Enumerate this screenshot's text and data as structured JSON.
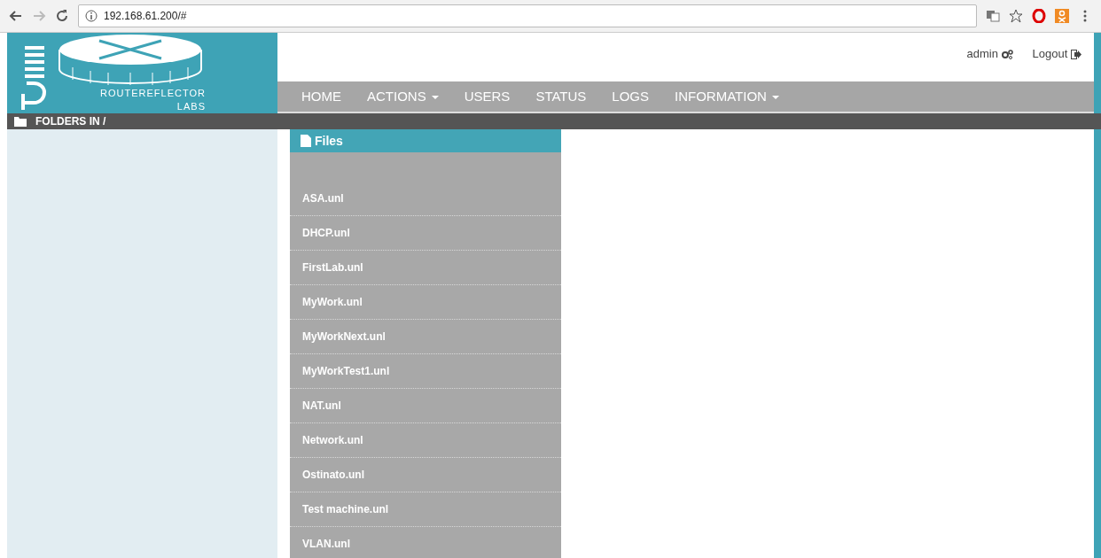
{
  "browser": {
    "address": "192.168.61.200/#"
  },
  "logo": {
    "line_1": "ROUTEREFLECTOR",
    "line_2": "LABS"
  },
  "user_menu": {
    "user": "admin",
    "logout": "Logout"
  },
  "nav": [
    {
      "label": "HOME",
      "dropdown": false
    },
    {
      "label": "ACTIONS",
      "dropdown": true
    },
    {
      "label": "USERS",
      "dropdown": false
    },
    {
      "label": "STATUS",
      "dropdown": false
    },
    {
      "label": "LOGS",
      "dropdown": false
    },
    {
      "label": "INFORMATION",
      "dropdown": true
    }
  ],
  "folders_bar": {
    "title": "FOLDERS IN /"
  },
  "files": {
    "title": "Files",
    "items": [
      "ASA.unl",
      "DHCP.unl",
      "FirstLab.unl",
      "MyWork.unl",
      "MyWorkNext.unl",
      "MyWorkTest1.unl",
      "NAT.unl",
      "Network.unl",
      "Ostinato.unl",
      "Test machine.unl",
      "VLAN.unl"
    ]
  }
}
